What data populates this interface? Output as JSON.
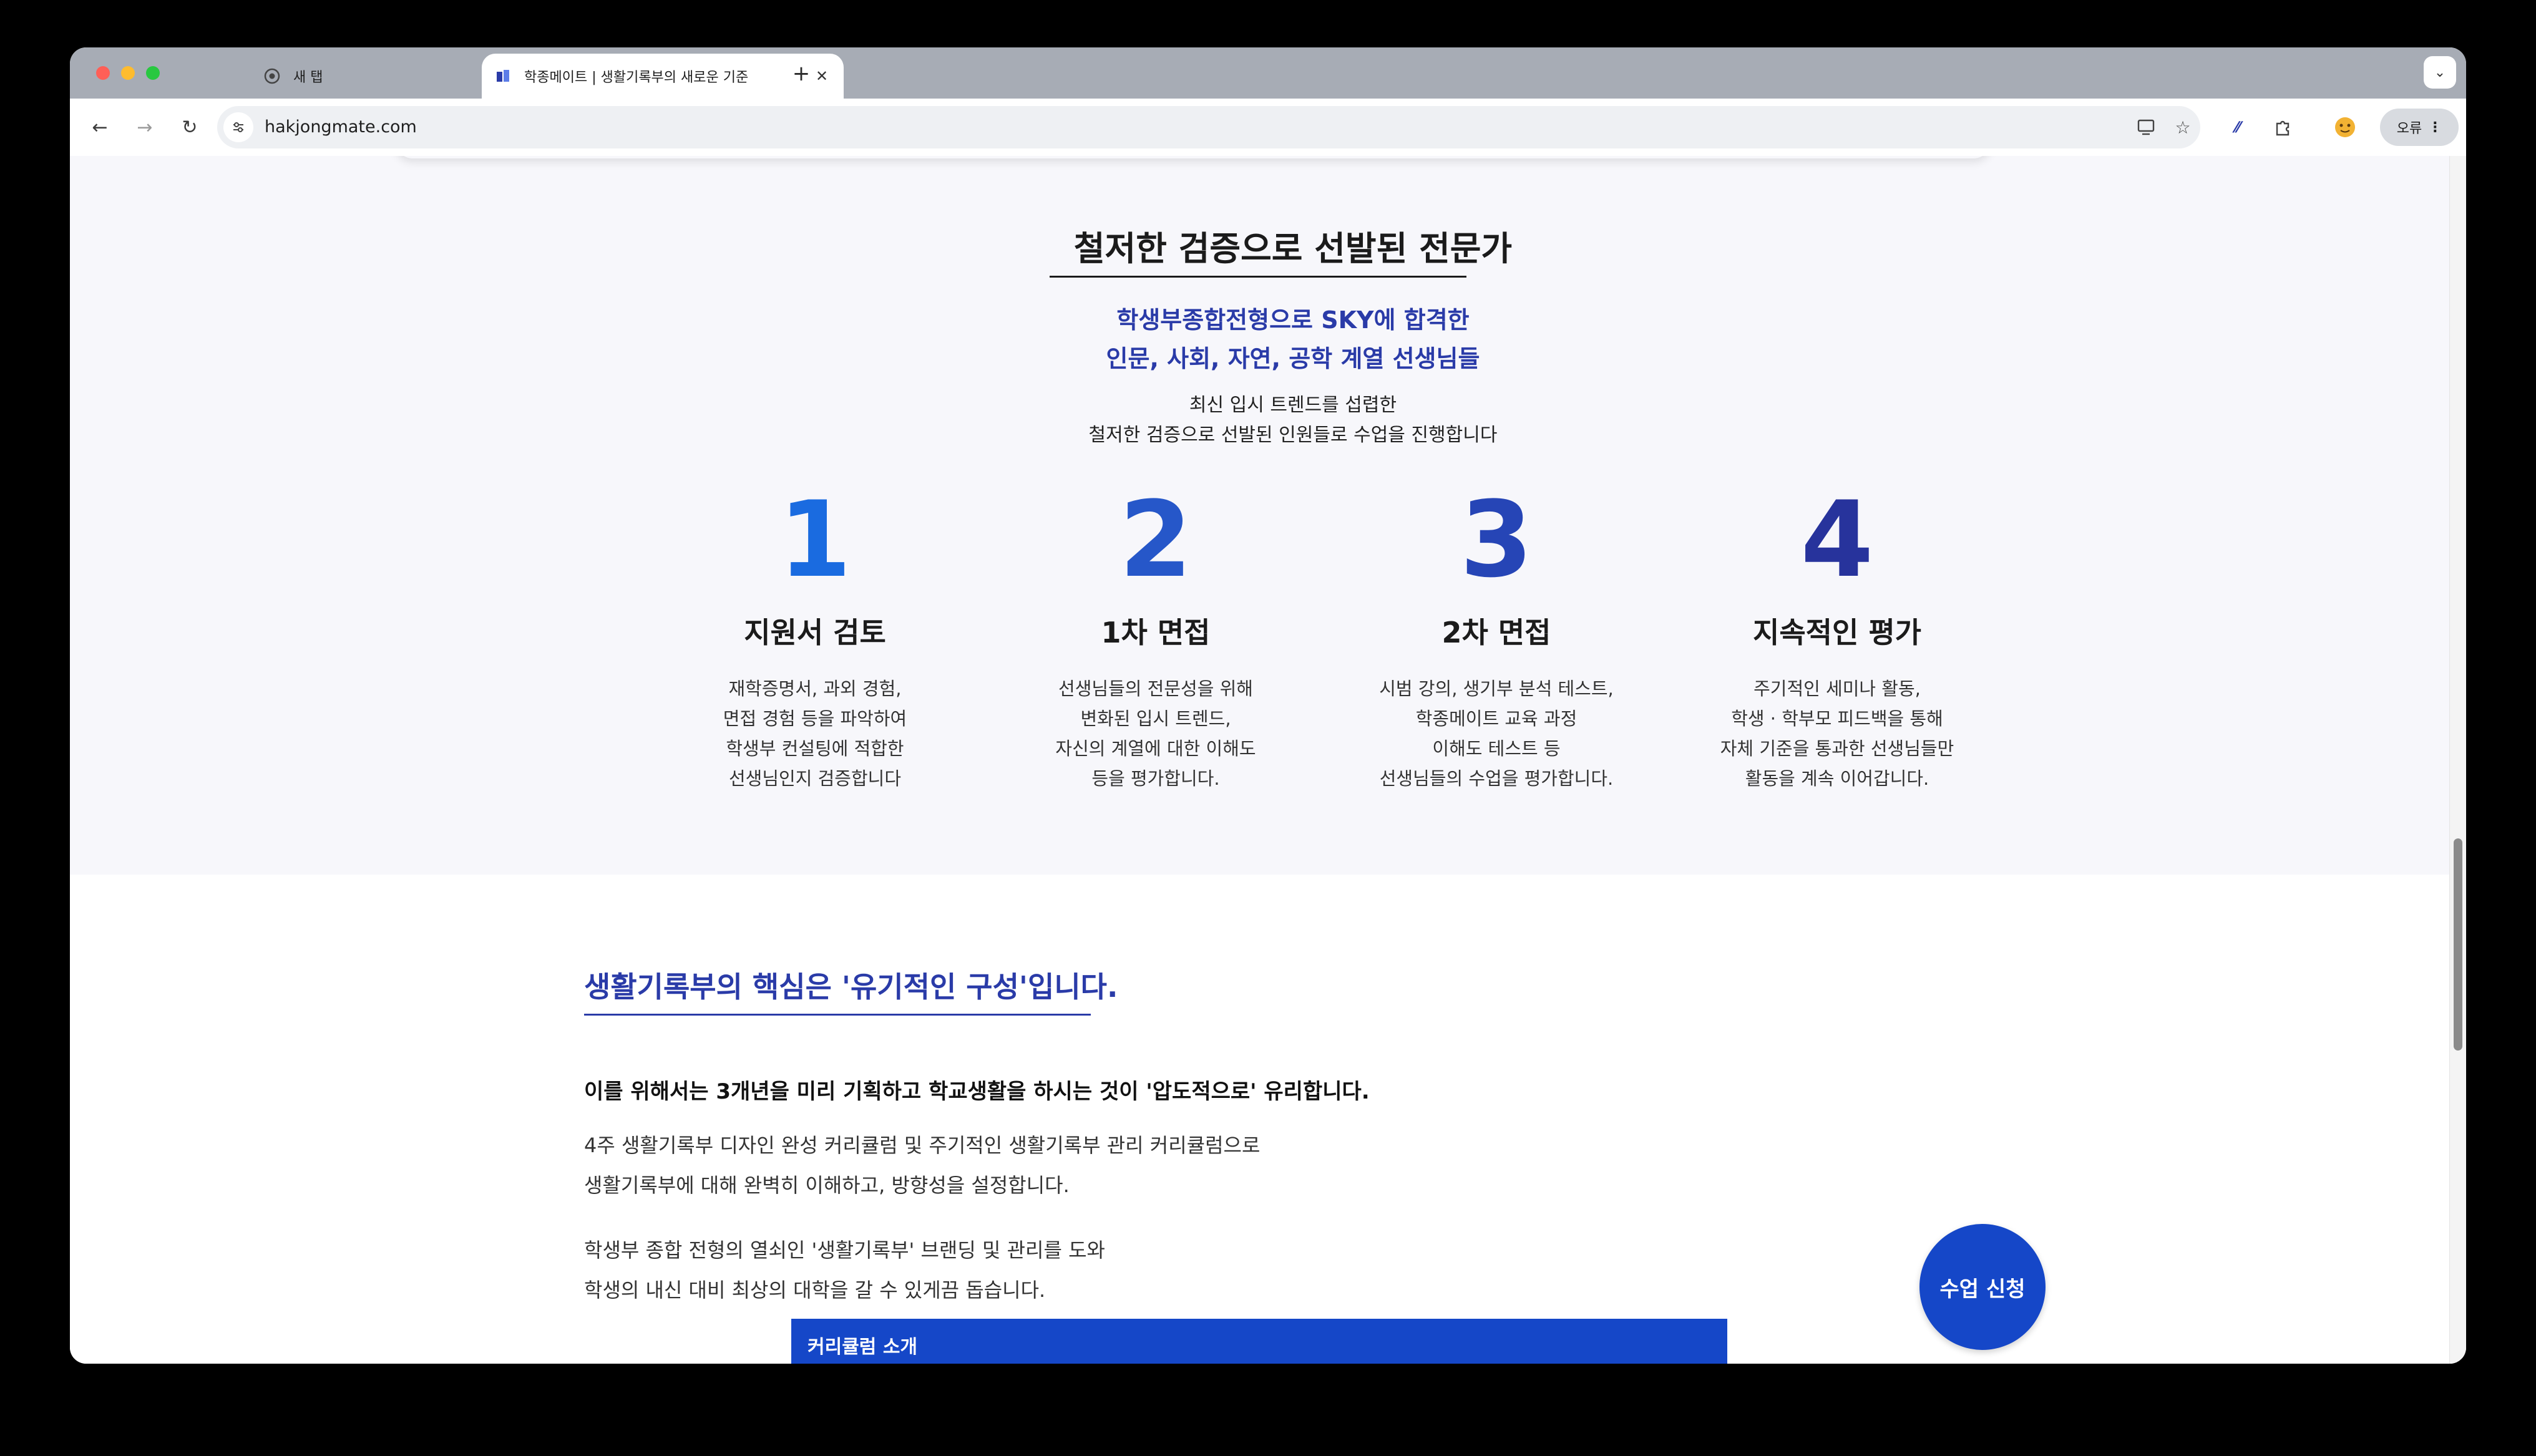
{
  "browser": {
    "tabs": [
      {
        "title": "새 탭",
        "active": false,
        "icon": "chrome-icon"
      },
      {
        "title": "학종메이트 | 생활기록부의 새로운 기준",
        "active": true,
        "icon": "site-favicon"
      }
    ],
    "close_glyph": "✕",
    "new_tab_glyph": "+",
    "tab_search_glyph": "⌄",
    "url": "hakjongmate.com",
    "profile_label": "오류",
    "nav": {
      "back": "←",
      "forward": "→",
      "reload": "↻"
    }
  },
  "experts": {
    "title": "철저한 검증으로 선발된 전문가",
    "subtitle_blue_line1": "학생부종합전형으로 SKY에 합격한",
    "subtitle_blue_line2": "인문, 사회, 자연, 공학 계열 선생님들",
    "subtitle_line1": "최신 입시 트렌드를 섭렵한",
    "subtitle_line2": "철저한 검증으로 선발된 인원들로 수업을 진행합니다",
    "steps": [
      {
        "number": "1",
        "title": "지원서 검토",
        "description": "재학증명서, 과외 경험,\n면접 경험 등을 파악하여\n학생부 컨설팅에 적합한\n선생님인지 검증합니다",
        "color": "#1a6be0"
      },
      {
        "number": "2",
        "title": "1차 면접",
        "description": "선생님들의 전문성을 위해\n변화된 입시 트렌드,\n자신의 계열에 대한 이해도\n등을 평가합니다.",
        "color": "#2657c9"
      },
      {
        "number": "3",
        "title": "2차 면접",
        "description": "시범 강의, 생기부 분석 테스트,\n학종메이트 교육 과정\n이해도 테스트 등\n선생님들의 수업을 평가합니다.",
        "color": "#2645b6"
      },
      {
        "number": "4",
        "title": "지속적인 평가",
        "description": "주기적인 세미나 활동,\n학생 · 학부모 피드백을 통해\n자체 기준을 통과한 선생님들만\n활동을 계속 이어갑니다.",
        "color": "#27339c"
      }
    ]
  },
  "core": {
    "heading": "생활기록부의 핵심은 '유기적인 구성'입니다.",
    "bold_line": "이를 위해서는 3개년을 미리 기획하고 학교생활을 하시는 것이 '압도적으로' 유리합니다.",
    "para1_line1": "4주 생활기록부 디자인 완성 커리큘럼 및 주기적인 생활기록부 관리 커리큘럼으로",
    "para1_line2": "생활기록부에 대해 완벽히 이해하고, 방향성을 설정합니다.",
    "para2_line1": "학생부 종합 전형의 열쇠인 '생활기록부' 브랜딩 및 관리를 도와",
    "para2_line2": "학생의 내신 대비 최상의 대학을 갈 수 있게끔 돕습니다.",
    "curriculum_label": "커리큘럼 소개",
    "cta_label": "수업 신청"
  }
}
